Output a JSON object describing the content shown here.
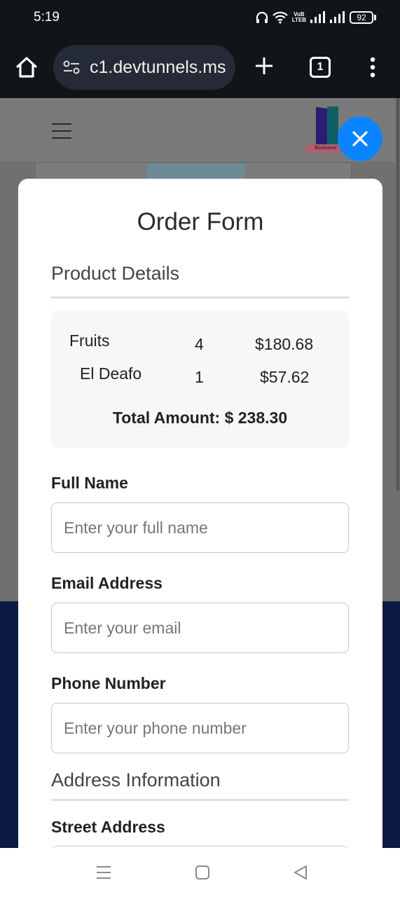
{
  "status_bar": {
    "time": "5:19",
    "network_label_top": "VoB",
    "network_label_bottom": "LTEB",
    "battery": "92",
    "icons": [
      "headphones-icon",
      "wifi-icon",
      "volte-icon",
      "signal-icon",
      "signal-icon",
      "battery-icon"
    ]
  },
  "browser": {
    "url": "c1.devtunnels.ms",
    "tab_count": "1",
    "icons": [
      "home-icon",
      "site-settings-icon",
      "plus-icon",
      "tabs-icon",
      "more-vert-icon"
    ]
  },
  "background_page": {
    "logo_text": "Bookstore",
    "footer_color": "#0e1a42"
  },
  "modal": {
    "title": "Order Form",
    "product_section": "Product Details",
    "products": [
      {
        "name": "Fruits",
        "qty": "4",
        "price": "$180.68"
      },
      {
        "name": "El Deafo",
        "qty": "1",
        "price": "$57.62"
      }
    ],
    "total": "Total Amount: $ 238.30",
    "fields": {
      "full_name": {
        "label": "Full Name",
        "placeholder": "Enter your full name"
      },
      "email": {
        "label": "Email Address",
        "placeholder": "Enter your email"
      },
      "phone": {
        "label": "Phone Number",
        "placeholder": "Enter your phone number"
      }
    },
    "address_section": "Address Information",
    "street": {
      "label": "Street Address"
    }
  },
  "colors": {
    "accent": "#0d84ff",
    "browser_bar": "#111418",
    "url_pill": "#252b36",
    "overlay": "#707070"
  },
  "nav_bar": {
    "icons": [
      "recents-icon",
      "home-square-icon",
      "back-triangle-icon"
    ]
  }
}
